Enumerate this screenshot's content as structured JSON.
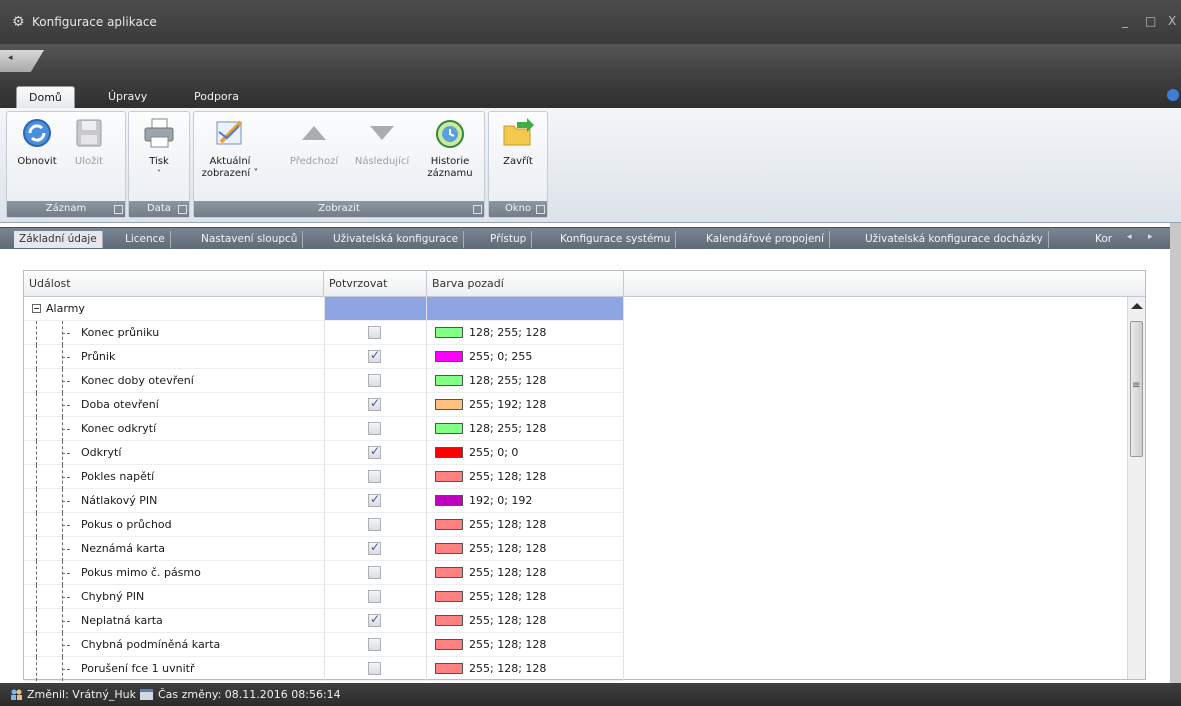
{
  "window": {
    "title": "Konfigurace aplikace",
    "controls": {
      "minimize": "_",
      "maximize": "□",
      "close": "X"
    },
    "qat_label": "◂"
  },
  "ribbon_tabs": [
    {
      "label": "Domů",
      "active": true
    },
    {
      "label": "Úpravy",
      "active": false
    },
    {
      "label": "Podpora",
      "active": false
    }
  ],
  "ribbon": {
    "groups": {
      "zaznam": "Záznam",
      "data": "Data",
      "zobrazit": "Zobrazit",
      "okno": "Okno"
    },
    "buttons": {
      "obnovit": "Obnovit",
      "ulozit": "Uložit",
      "tisk": "Tisk",
      "aktualni_1": "Aktuální",
      "aktualni_2": "zobrazení ˅",
      "predchozi": "Předchozí",
      "nasledujici": "Následující",
      "historie_1": "Historie",
      "historie_2": "záznamu",
      "zavrit": "Zavřít"
    }
  },
  "sub_tabs": [
    "Základní údaje",
    "Licence",
    "Nastavení sloupců",
    "Uživatelská konfigurace",
    "Přístup",
    "Konfigurace systému",
    "Kalendářové propojení",
    "Uživatelská konfigurace docházky",
    "Kor"
  ],
  "grid": {
    "columns": [
      "Událost",
      "Potvrzovat",
      "Barva pozadí"
    ],
    "group_label": "Alarmy",
    "rows": [
      {
        "event": "Konec průniku",
        "confirm": false,
        "color": "#80ff80",
        "color_text": "128; 255; 128"
      },
      {
        "event": "Průnik",
        "confirm": true,
        "color": "#ff00ff",
        "color_text": "255; 0; 255"
      },
      {
        "event": "Konec doby otevření",
        "confirm": false,
        "color": "#80ff80",
        "color_text": "128; 255; 128"
      },
      {
        "event": "Doba otevření",
        "confirm": true,
        "color": "#ffc080",
        "color_text": "255; 192; 128"
      },
      {
        "event": "Konec odkrytí",
        "confirm": false,
        "color": "#80ff80",
        "color_text": "128; 255; 128"
      },
      {
        "event": "Odkrytí",
        "confirm": true,
        "color": "#ff0000",
        "color_text": "255; 0; 0"
      },
      {
        "event": "Pokles napětí",
        "confirm": false,
        "color": "#ff8080",
        "color_text": "255; 128; 128"
      },
      {
        "event": "Nátlakový PIN",
        "confirm": true,
        "color": "#c000c0",
        "color_text": "192; 0; 192"
      },
      {
        "event": "Pokus o průchod",
        "confirm": false,
        "color": "#ff8080",
        "color_text": "255; 128; 128"
      },
      {
        "event": "Neznámá karta",
        "confirm": true,
        "color": "#ff8080",
        "color_text": "255; 128; 128"
      },
      {
        "event": "Pokus mimo č. pásmo",
        "confirm": false,
        "color": "#ff8080",
        "color_text": "255; 128; 128"
      },
      {
        "event": "Chybný PIN",
        "confirm": false,
        "color": "#ff8080",
        "color_text": "255; 128; 128"
      },
      {
        "event": "Neplatná karta",
        "confirm": true,
        "color": "#ff8080",
        "color_text": "255; 128; 128"
      },
      {
        "event": "Chybná podmíněná karta",
        "confirm": false,
        "color": "#ff8080",
        "color_text": "255; 128; 128"
      },
      {
        "event": "Porušení fce 1 uvnitř",
        "confirm": false,
        "color": "#ff8080",
        "color_text": "255; 128; 128"
      }
    ]
  },
  "status": {
    "changed_by": "Změnil: Vrátný_Huk",
    "changed_at": "Čas změny: 08.11.2016 08:56:14"
  }
}
